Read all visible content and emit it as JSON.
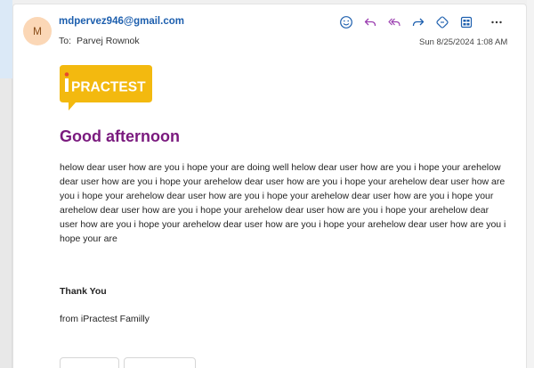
{
  "email": {
    "avatar_initial": "M",
    "sender": "mdpervez946@gmail.com",
    "to_label": "To:",
    "recipient": "Parvej Rownok",
    "datetime": "Sun 8/25/2024 1:08 AM"
  },
  "toolbar": {
    "icons": [
      "smiley-icon",
      "reply-icon",
      "reply-all-icon",
      "forward-icon",
      "apps-icon",
      "immersive-reader-icon",
      "more-icon"
    ],
    "accent": "#1d5fae"
  },
  "logo": {
    "text": "PRACTEST",
    "bg_color": "#f3b90f",
    "accent_color": "#e84a2a"
  },
  "message": {
    "greeting": "Good afternoon",
    "greeting_color": "#7a1a7e",
    "body": "helow dear user how are you i hope your are doing well helow dear user how are you i hope your arehelow dear user how are you i hope your arehelow dear user how are you i hope your arehelow dear user how are you i hope your arehelow dear user how are you i hope your arehelow dear user how are you i hope your arehelow dear user how are you i hope your arehelow dear user how are you i hope your arehelow dear user how are you i hope your arehelow dear user how are you i hope your arehelow dear user how are you i hope your are",
    "thanks": "Thank You",
    "signature": "from iPractest Familly"
  }
}
